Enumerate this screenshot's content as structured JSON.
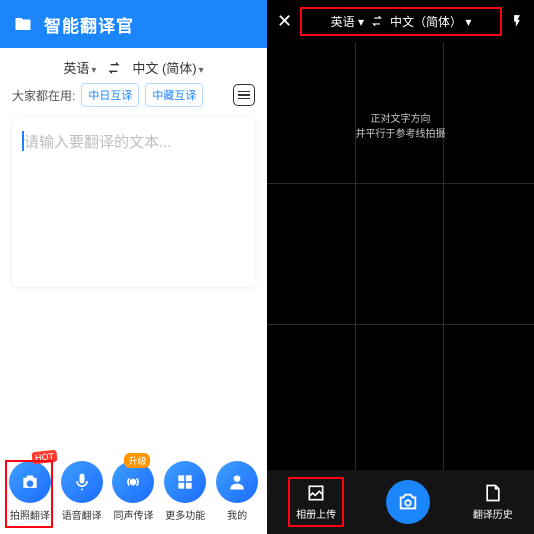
{
  "left": {
    "title": "智能翻译官",
    "source_lang": "英语",
    "target_lang": "中文 (简体)",
    "use_label": "大家都在用:",
    "chips": [
      "中日互译",
      "中藏互译"
    ],
    "placeholder": "请输入要翻译的文本...",
    "nav": [
      {
        "label": "拍照翻译",
        "badge": "HOT"
      },
      {
        "label": "语音翻译"
      },
      {
        "label": "同声传译",
        "badge": "升级"
      },
      {
        "label": "更多功能"
      },
      {
        "label": "我的"
      }
    ]
  },
  "right": {
    "source_lang": "英语",
    "target_lang": "中文（简体）",
    "hint1": "正对文字方向",
    "hint2": "并平行于参考线拍摄",
    "upload_label": "相册上传",
    "history_label": "翻译历史"
  }
}
